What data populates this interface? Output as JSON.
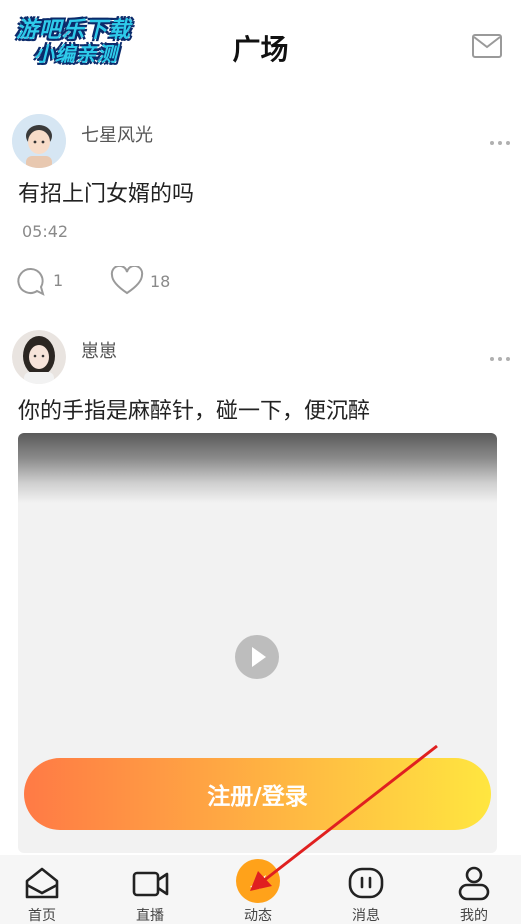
{
  "watermark": {
    "line1": "游吧乐下载",
    "line2": "小编亲测"
  },
  "header": {
    "title": "广场"
  },
  "posts": [
    {
      "username": "七星风光",
      "content": "有招上门女婿的吗",
      "time": "05:42",
      "comments": "1",
      "likes": "18"
    },
    {
      "username": "崽崽",
      "content": "你的手指是麻醉针，碰一下，便沉醉"
    }
  ],
  "login_button": {
    "label": "注册/登录"
  },
  "nav": {
    "items": [
      {
        "label": "首页",
        "icon": "home-icon"
      },
      {
        "label": "直播",
        "icon": "video-camera-icon"
      },
      {
        "label": "动态",
        "icon": "send-icon"
      },
      {
        "label": "消息",
        "icon": "message-icon"
      },
      {
        "label": "我的",
        "icon": "user-icon"
      }
    ]
  },
  "colors": {
    "accent_orange": "#ff7a45",
    "accent_yellow": "#ffe640",
    "nav_active": "#ffa21a",
    "annotation_arrow": "#e02020"
  }
}
